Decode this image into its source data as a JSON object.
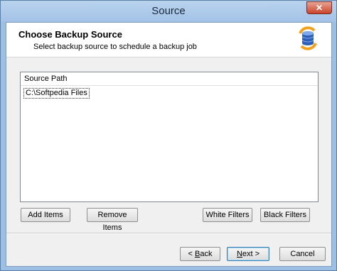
{
  "window": {
    "title": "Source",
    "close_label": "✕"
  },
  "header": {
    "title": "Choose Backup Source",
    "subtitle": "Select backup source to schedule a backup job",
    "icon": "backup-database-icon"
  },
  "source_list": {
    "column_header": "Source Path",
    "rows": [
      "C:\\Softpedia Files"
    ]
  },
  "actions": {
    "add_items": "Add Items",
    "remove_items": "Remove Items",
    "white_filters": "White Filters",
    "black_filters": "Black Filters"
  },
  "nav": {
    "back_prefix": "< ",
    "back_mnemonic": "B",
    "back_rest": "ack",
    "next_mnemonic": "N",
    "next_rest": "ext >",
    "cancel": "Cancel"
  },
  "colors": {
    "title_bar": "#a3c2e6",
    "close_button": "#c8442a",
    "accent": "#3c7fb1"
  }
}
